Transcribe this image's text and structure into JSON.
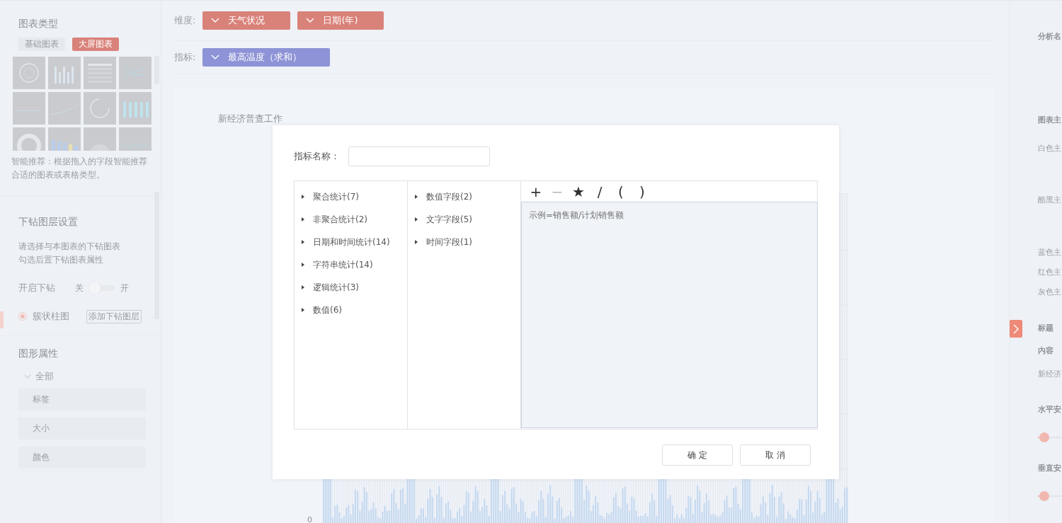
{
  "sidebar": {
    "chart_type": {
      "title": "图表类型",
      "tabs": [
        {
          "label": "基础图表",
          "selected": false
        },
        {
          "label": "大屏图表",
          "selected": true
        }
      ],
      "thumbnails": [
        {
          "kind": "ring"
        },
        {
          "kind": "bar"
        },
        {
          "kind": "table"
        },
        {
          "kind": "line"
        },
        {
          "kind": "dash"
        },
        {
          "kind": "area"
        },
        {
          "kind": "gauge"
        },
        {
          "kind": "cylinder"
        },
        {
          "kind": "donut"
        },
        {
          "kind": "gradient"
        },
        {
          "kind": "radar"
        },
        {
          "kind": "wave"
        }
      ],
      "hint": "智能推荐：根据拖入的字段智能推荐合适的图表或表格类型。"
    },
    "drill": {
      "title": "下钻图层设置",
      "description": [
        "请选择与本图表的下钻图表",
        "勾选后置下钻图表属性"
      ],
      "toggle": {
        "label": "开启下钻",
        "off_label": "关",
        "on_label": "开",
        "on": false
      },
      "radio": {
        "label": "簇状柱图",
        "selected": true
      },
      "add_button": "添加下钻图层"
    },
    "properties": {
      "title": "图形属性",
      "group": {
        "label": "全部",
        "expanded": true
      },
      "items": [
        "标签",
        "大小",
        "颜色"
      ]
    }
  },
  "toolbar": {
    "dimensions": {
      "label": "维度:",
      "fields": [
        "天气状况",
        "日期(年)"
      ]
    },
    "measures": {
      "label": "指标:",
      "fields": [
        "最高温度（求和）"
      ]
    }
  },
  "chart": {
    "title": "新经济普查工作",
    "y_tick": "0"
  },
  "right_panel": {
    "items": [
      {
        "kind": "heading",
        "text": "分析名"
      },
      {
        "kind": "heading",
        "text": "图表主"
      },
      {
        "kind": "option",
        "text": "白色主"
      },
      {
        "kind": "option",
        "text": "酷黑主"
      },
      {
        "kind": "option",
        "text": "蓝色主"
      },
      {
        "kind": "option",
        "text": "红色主"
      },
      {
        "kind": "option",
        "text": "灰色主"
      },
      {
        "kind": "heading",
        "text": "标题"
      },
      {
        "kind": "heading",
        "text": "内容"
      },
      {
        "kind": "option",
        "text": "新经济"
      },
      {
        "kind": "heading",
        "text": "水平安"
      },
      {
        "kind": "slider",
        "level": 0.05
      },
      {
        "kind": "heading",
        "text": "垂直安"
      },
      {
        "kind": "slider",
        "level": 0.05
      }
    ]
  },
  "dialog": {
    "name_label": "指标名称：",
    "functions": [
      {
        "label": "聚合统计(7)",
        "expanded": false
      },
      {
        "label": "非聚合统计(2)",
        "expanded": false
      },
      {
        "label": "日期和时间统计(14)",
        "expanded": false
      },
      {
        "label": "字符串统计(14)",
        "expanded": false
      },
      {
        "label": "逻辑统计(3)",
        "expanded": false
      },
      {
        "label": "数值(6)",
        "expanded": false
      }
    ],
    "fields": [
      {
        "label": "数值字段(2)",
        "expanded": false
      },
      {
        "label": "文字字段(5)",
        "expanded": false
      },
      {
        "label": "时间字段(1)",
        "expanded": false
      }
    ],
    "operators": [
      {
        "symbol": "+",
        "disabled": false
      },
      {
        "symbol": "−",
        "disabled": true
      },
      {
        "symbol": "★",
        "disabled": false
      },
      {
        "symbol": "/",
        "disabled": false
      },
      {
        "symbol": "(",
        "disabled": false
      },
      {
        "symbol": ")",
        "disabled": false
      }
    ],
    "formula_placeholder": "示例=销售额/计划销售额",
    "buttons": [
      "确 定",
      "取 消"
    ]
  }
}
